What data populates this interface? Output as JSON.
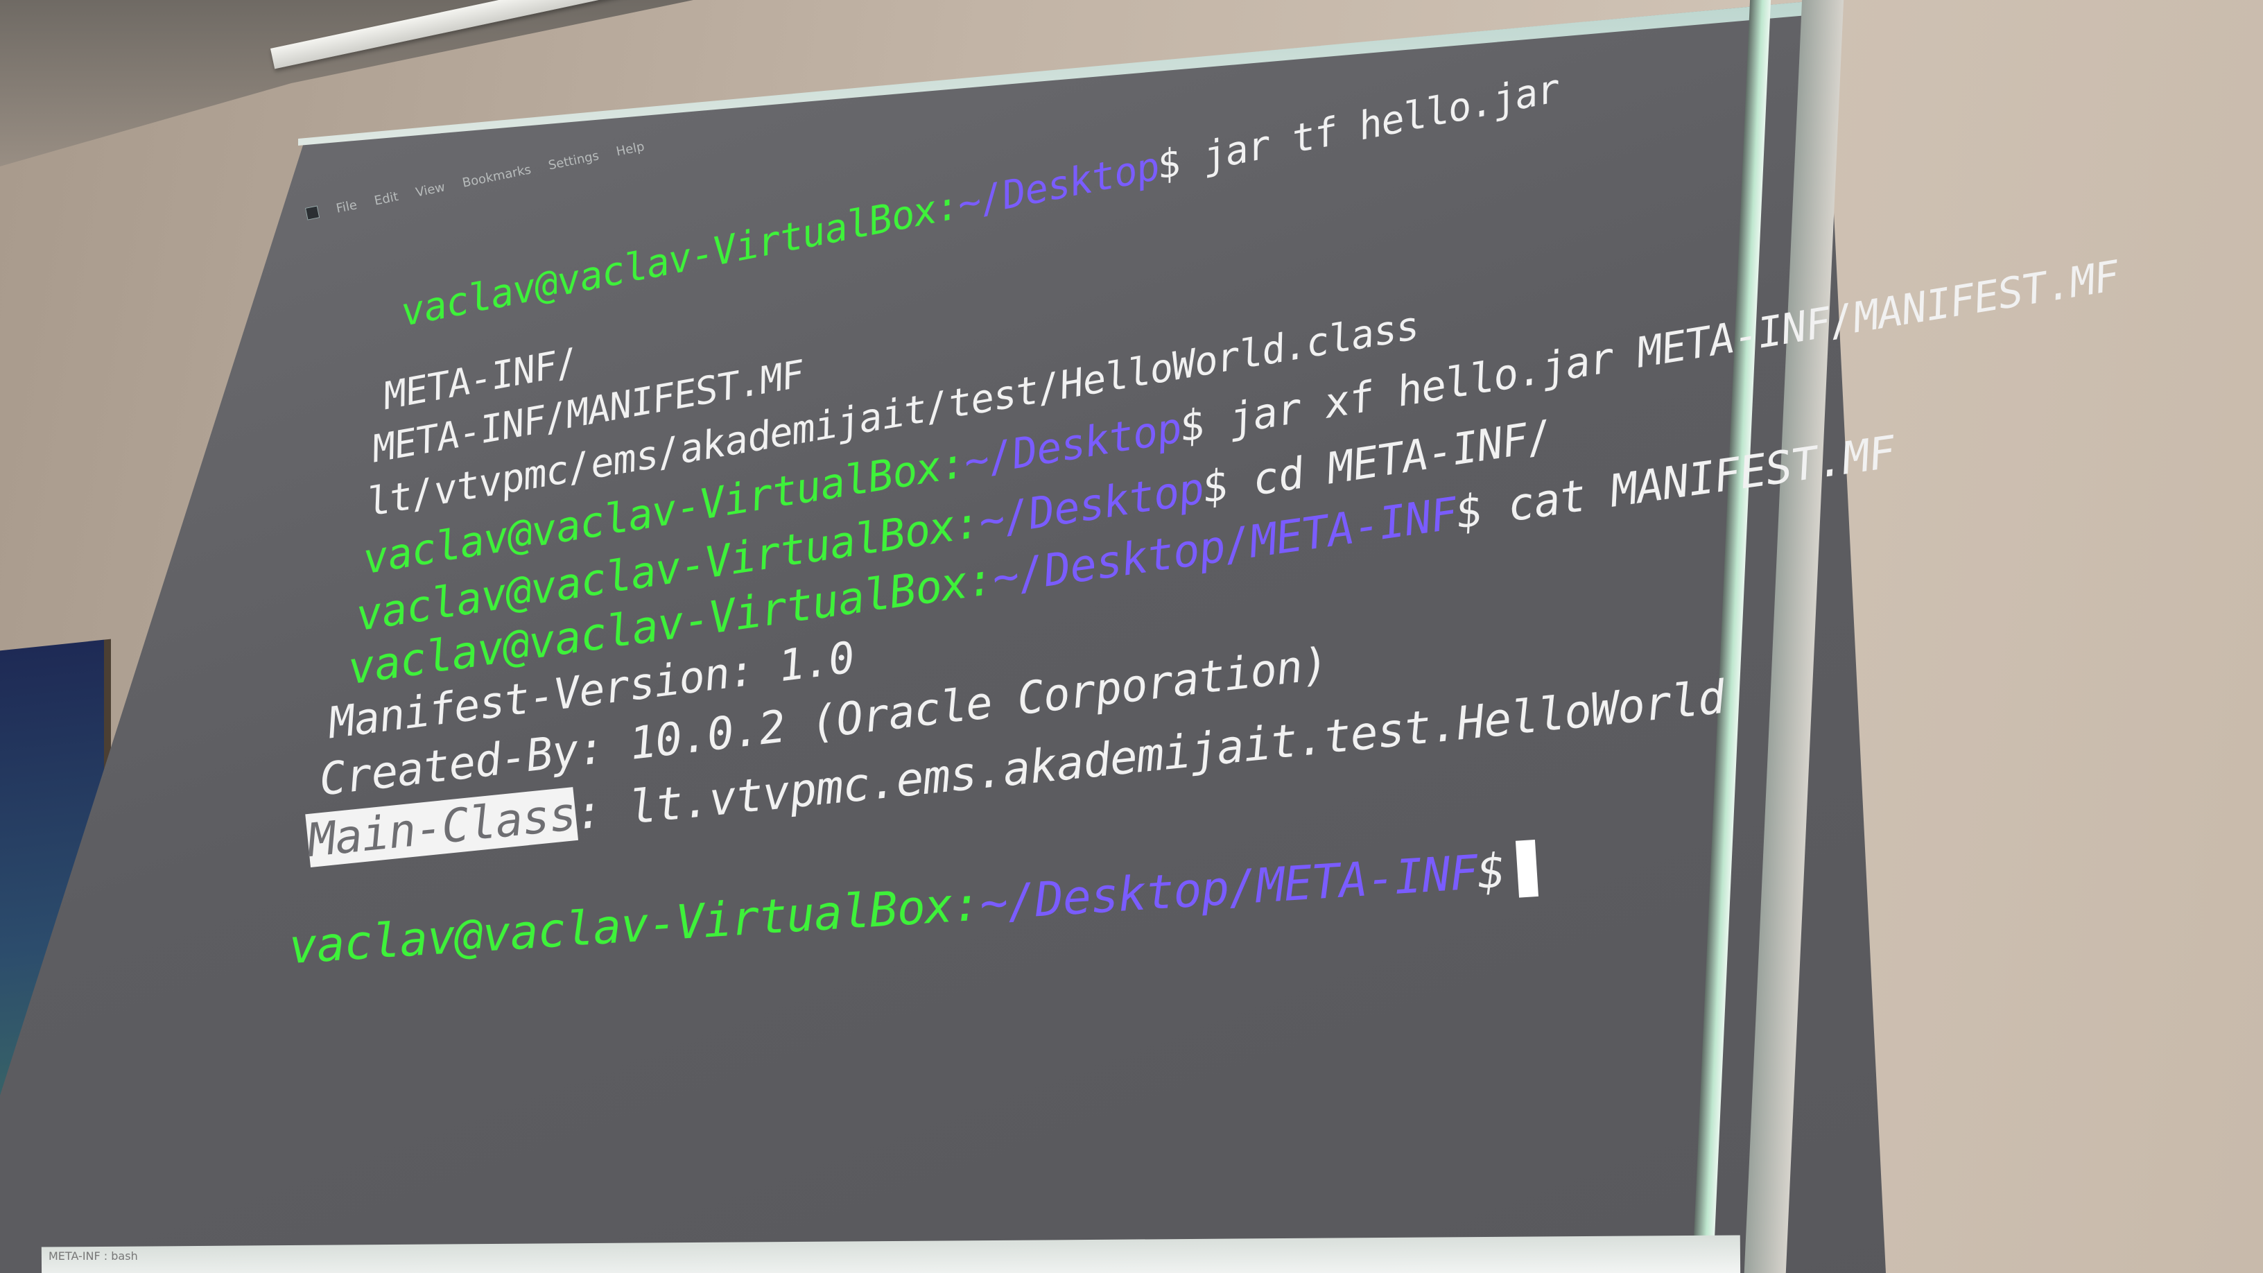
{
  "menubar": {
    "items": [
      "File",
      "Edit",
      "View",
      "Bookmarks",
      "Settings",
      "Help"
    ]
  },
  "terminal": {
    "prompt_user": "vaclav@vaclav-VirtualBox",
    "lines": [
      {
        "type": "prompt",
        "path": "~/Desktop",
        "command": "jar tf hello.jar"
      },
      {
        "type": "output",
        "text": "META-INF/"
      },
      {
        "type": "output",
        "text": "META-INF/MANIFEST.MF"
      },
      {
        "type": "output",
        "text": "lt/vtvpmc/ems/akademijait/test/HelloWorld.class"
      },
      {
        "type": "prompt",
        "path": "~/Desktop",
        "command": "jar xf hello.jar META-INF/MANIFEST.MF"
      },
      {
        "type": "prompt",
        "path": "~/Desktop",
        "command": "cd META-INF/"
      },
      {
        "type": "prompt",
        "path": "~/Desktop/META-INF",
        "command": "cat MANIFEST.MF"
      },
      {
        "type": "output",
        "text": "Manifest-Version: 1.0"
      },
      {
        "type": "output",
        "text": "Created-By: 10.0.2 (Oracle Corporation)"
      },
      {
        "type": "highlighted",
        "highlight": "Main-Class",
        "text": ": lt.vtvpmc.ems.akademijait.test.HelloWorld"
      },
      {
        "type": "prompt",
        "path": "~/Desktop/META-INF",
        "command": ""
      }
    ]
  },
  "taskbar": {
    "item": "META-INF : bash"
  },
  "colors": {
    "prompt_user": "#3ef23a",
    "prompt_path": "#7a5cff",
    "text": "#f1f1f1",
    "background": "#5d5d61"
  }
}
